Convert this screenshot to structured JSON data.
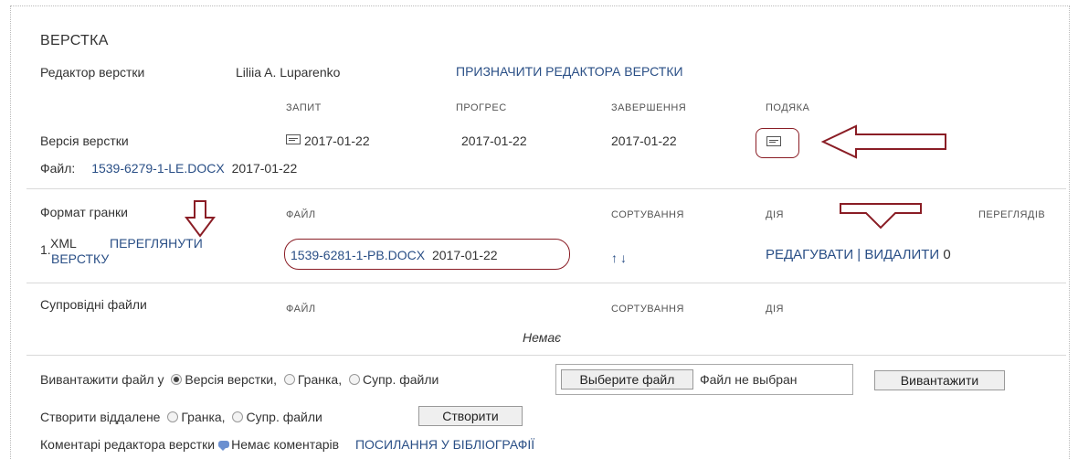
{
  "section_title": "ВЕРСТКА",
  "editor": {
    "label": "Редактор верстки",
    "name": "Liliia A. Luparenko",
    "assign_link": "ПРИЗНАЧИТИ РЕДАКТОРА ВЕРСТКИ"
  },
  "columns": {
    "request": "ЗАПИТ",
    "progress": "ПРОГРЕС",
    "completion": "ЗАВЕРШЕННЯ",
    "thanks": "ПОДЯКА"
  },
  "version_row": {
    "label": "Версія верстки",
    "request_date": "2017-01-22",
    "progress_date": "2017-01-22",
    "completion_date": "2017-01-22"
  },
  "file_row": {
    "label": "Файл:",
    "file_link": "1539-6279-1-LE.DOCX",
    "date": "2017-01-22"
  },
  "galley": {
    "label": "Формат гранки",
    "col_file": "ФАЙЛ",
    "col_sort": "СОРТУВАННЯ",
    "col_action": "ДІЯ",
    "col_views": "ПЕРЕГЛЯДІВ",
    "row": {
      "number": "1.",
      "format": "XML",
      "view_link": "ПЕРЕГЛЯНУТИ ВЕРСТКУ",
      "file_link": "1539-6281-1-PB.DOCX",
      "file_date": "2017-01-22",
      "sort_arrows": "↑↓",
      "edit_link": "РЕДАГУВАТИ",
      "separator": "|",
      "delete_link": "ВИДАЛИТИ",
      "views": "0"
    }
  },
  "supplementary": {
    "label": "Супровідні файли",
    "col_file": "ФАЙЛ",
    "col_sort": "СОРТУВАННЯ",
    "col_action": "ДІЯ",
    "empty": "Немає"
  },
  "upload": {
    "label": "Вивантажити файл у",
    "opt_version": "Версія верстки,",
    "opt_galley": "Гранка,",
    "opt_supp": "Супр. файли",
    "choose_button": "Выберите файл",
    "no_file": "Файл не выбран",
    "upload_button": "Вивантажити"
  },
  "remote": {
    "label": "Створити віддалене",
    "opt_galley": "Гранка,",
    "opt_supp": "Супр. файли",
    "create_button": "Створити"
  },
  "comments": {
    "label": "Коментарі редактора верстки",
    "none": "Немає коментарів",
    "references_link": "ПОСИЛАННЯ У БІБЛІОГРАФІЇ"
  },
  "annotation_color": "#8a1d25"
}
